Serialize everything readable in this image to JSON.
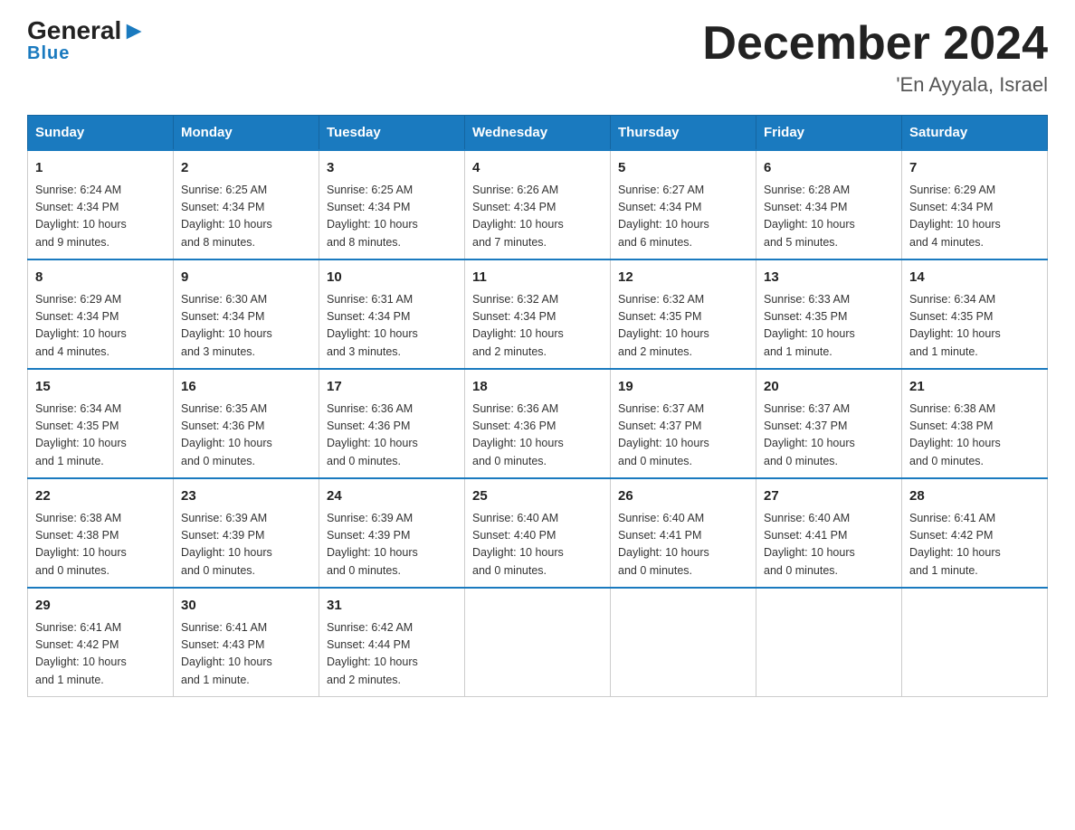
{
  "header": {
    "logo_text_black": "General",
    "logo_text_blue": "Blue",
    "month_title": "December 2024",
    "location": "'En Ayyala, Israel"
  },
  "days_of_week": [
    "Sunday",
    "Monday",
    "Tuesday",
    "Wednesday",
    "Thursday",
    "Friday",
    "Saturday"
  ],
  "weeks": [
    [
      {
        "day": "1",
        "sunrise": "6:24 AM",
        "sunset": "4:34 PM",
        "daylight": "10 hours and 9 minutes."
      },
      {
        "day": "2",
        "sunrise": "6:25 AM",
        "sunset": "4:34 PM",
        "daylight": "10 hours and 8 minutes."
      },
      {
        "day": "3",
        "sunrise": "6:25 AM",
        "sunset": "4:34 PM",
        "daylight": "10 hours and 8 minutes."
      },
      {
        "day": "4",
        "sunrise": "6:26 AM",
        "sunset": "4:34 PM",
        "daylight": "10 hours and 7 minutes."
      },
      {
        "day": "5",
        "sunrise": "6:27 AM",
        "sunset": "4:34 PM",
        "daylight": "10 hours and 6 minutes."
      },
      {
        "day": "6",
        "sunrise": "6:28 AM",
        "sunset": "4:34 PM",
        "daylight": "10 hours and 5 minutes."
      },
      {
        "day": "7",
        "sunrise": "6:29 AM",
        "sunset": "4:34 PM",
        "daylight": "10 hours and 4 minutes."
      }
    ],
    [
      {
        "day": "8",
        "sunrise": "6:29 AM",
        "sunset": "4:34 PM",
        "daylight": "10 hours and 4 minutes."
      },
      {
        "day": "9",
        "sunrise": "6:30 AM",
        "sunset": "4:34 PM",
        "daylight": "10 hours and 3 minutes."
      },
      {
        "day": "10",
        "sunrise": "6:31 AM",
        "sunset": "4:34 PM",
        "daylight": "10 hours and 3 minutes."
      },
      {
        "day": "11",
        "sunrise": "6:32 AM",
        "sunset": "4:34 PM",
        "daylight": "10 hours and 2 minutes."
      },
      {
        "day": "12",
        "sunrise": "6:32 AM",
        "sunset": "4:35 PM",
        "daylight": "10 hours and 2 minutes."
      },
      {
        "day": "13",
        "sunrise": "6:33 AM",
        "sunset": "4:35 PM",
        "daylight": "10 hours and 1 minute."
      },
      {
        "day": "14",
        "sunrise": "6:34 AM",
        "sunset": "4:35 PM",
        "daylight": "10 hours and 1 minute."
      }
    ],
    [
      {
        "day": "15",
        "sunrise": "6:34 AM",
        "sunset": "4:35 PM",
        "daylight": "10 hours and 1 minute."
      },
      {
        "day": "16",
        "sunrise": "6:35 AM",
        "sunset": "4:36 PM",
        "daylight": "10 hours and 0 minutes."
      },
      {
        "day": "17",
        "sunrise": "6:36 AM",
        "sunset": "4:36 PM",
        "daylight": "10 hours and 0 minutes."
      },
      {
        "day": "18",
        "sunrise": "6:36 AM",
        "sunset": "4:36 PM",
        "daylight": "10 hours and 0 minutes."
      },
      {
        "day": "19",
        "sunrise": "6:37 AM",
        "sunset": "4:37 PM",
        "daylight": "10 hours and 0 minutes."
      },
      {
        "day": "20",
        "sunrise": "6:37 AM",
        "sunset": "4:37 PM",
        "daylight": "10 hours and 0 minutes."
      },
      {
        "day": "21",
        "sunrise": "6:38 AM",
        "sunset": "4:38 PM",
        "daylight": "10 hours and 0 minutes."
      }
    ],
    [
      {
        "day": "22",
        "sunrise": "6:38 AM",
        "sunset": "4:38 PM",
        "daylight": "10 hours and 0 minutes."
      },
      {
        "day": "23",
        "sunrise": "6:39 AM",
        "sunset": "4:39 PM",
        "daylight": "10 hours and 0 minutes."
      },
      {
        "day": "24",
        "sunrise": "6:39 AM",
        "sunset": "4:39 PM",
        "daylight": "10 hours and 0 minutes."
      },
      {
        "day": "25",
        "sunrise": "6:40 AM",
        "sunset": "4:40 PM",
        "daylight": "10 hours and 0 minutes."
      },
      {
        "day": "26",
        "sunrise": "6:40 AM",
        "sunset": "4:41 PM",
        "daylight": "10 hours and 0 minutes."
      },
      {
        "day": "27",
        "sunrise": "6:40 AM",
        "sunset": "4:41 PM",
        "daylight": "10 hours and 0 minutes."
      },
      {
        "day": "28",
        "sunrise": "6:41 AM",
        "sunset": "4:42 PM",
        "daylight": "10 hours and 1 minute."
      }
    ],
    [
      {
        "day": "29",
        "sunrise": "6:41 AM",
        "sunset": "4:42 PM",
        "daylight": "10 hours and 1 minute."
      },
      {
        "day": "30",
        "sunrise": "6:41 AM",
        "sunset": "4:43 PM",
        "daylight": "10 hours and 1 minute."
      },
      {
        "day": "31",
        "sunrise": "6:42 AM",
        "sunset": "4:44 PM",
        "daylight": "10 hours and 2 minutes."
      },
      null,
      null,
      null,
      null
    ]
  ]
}
